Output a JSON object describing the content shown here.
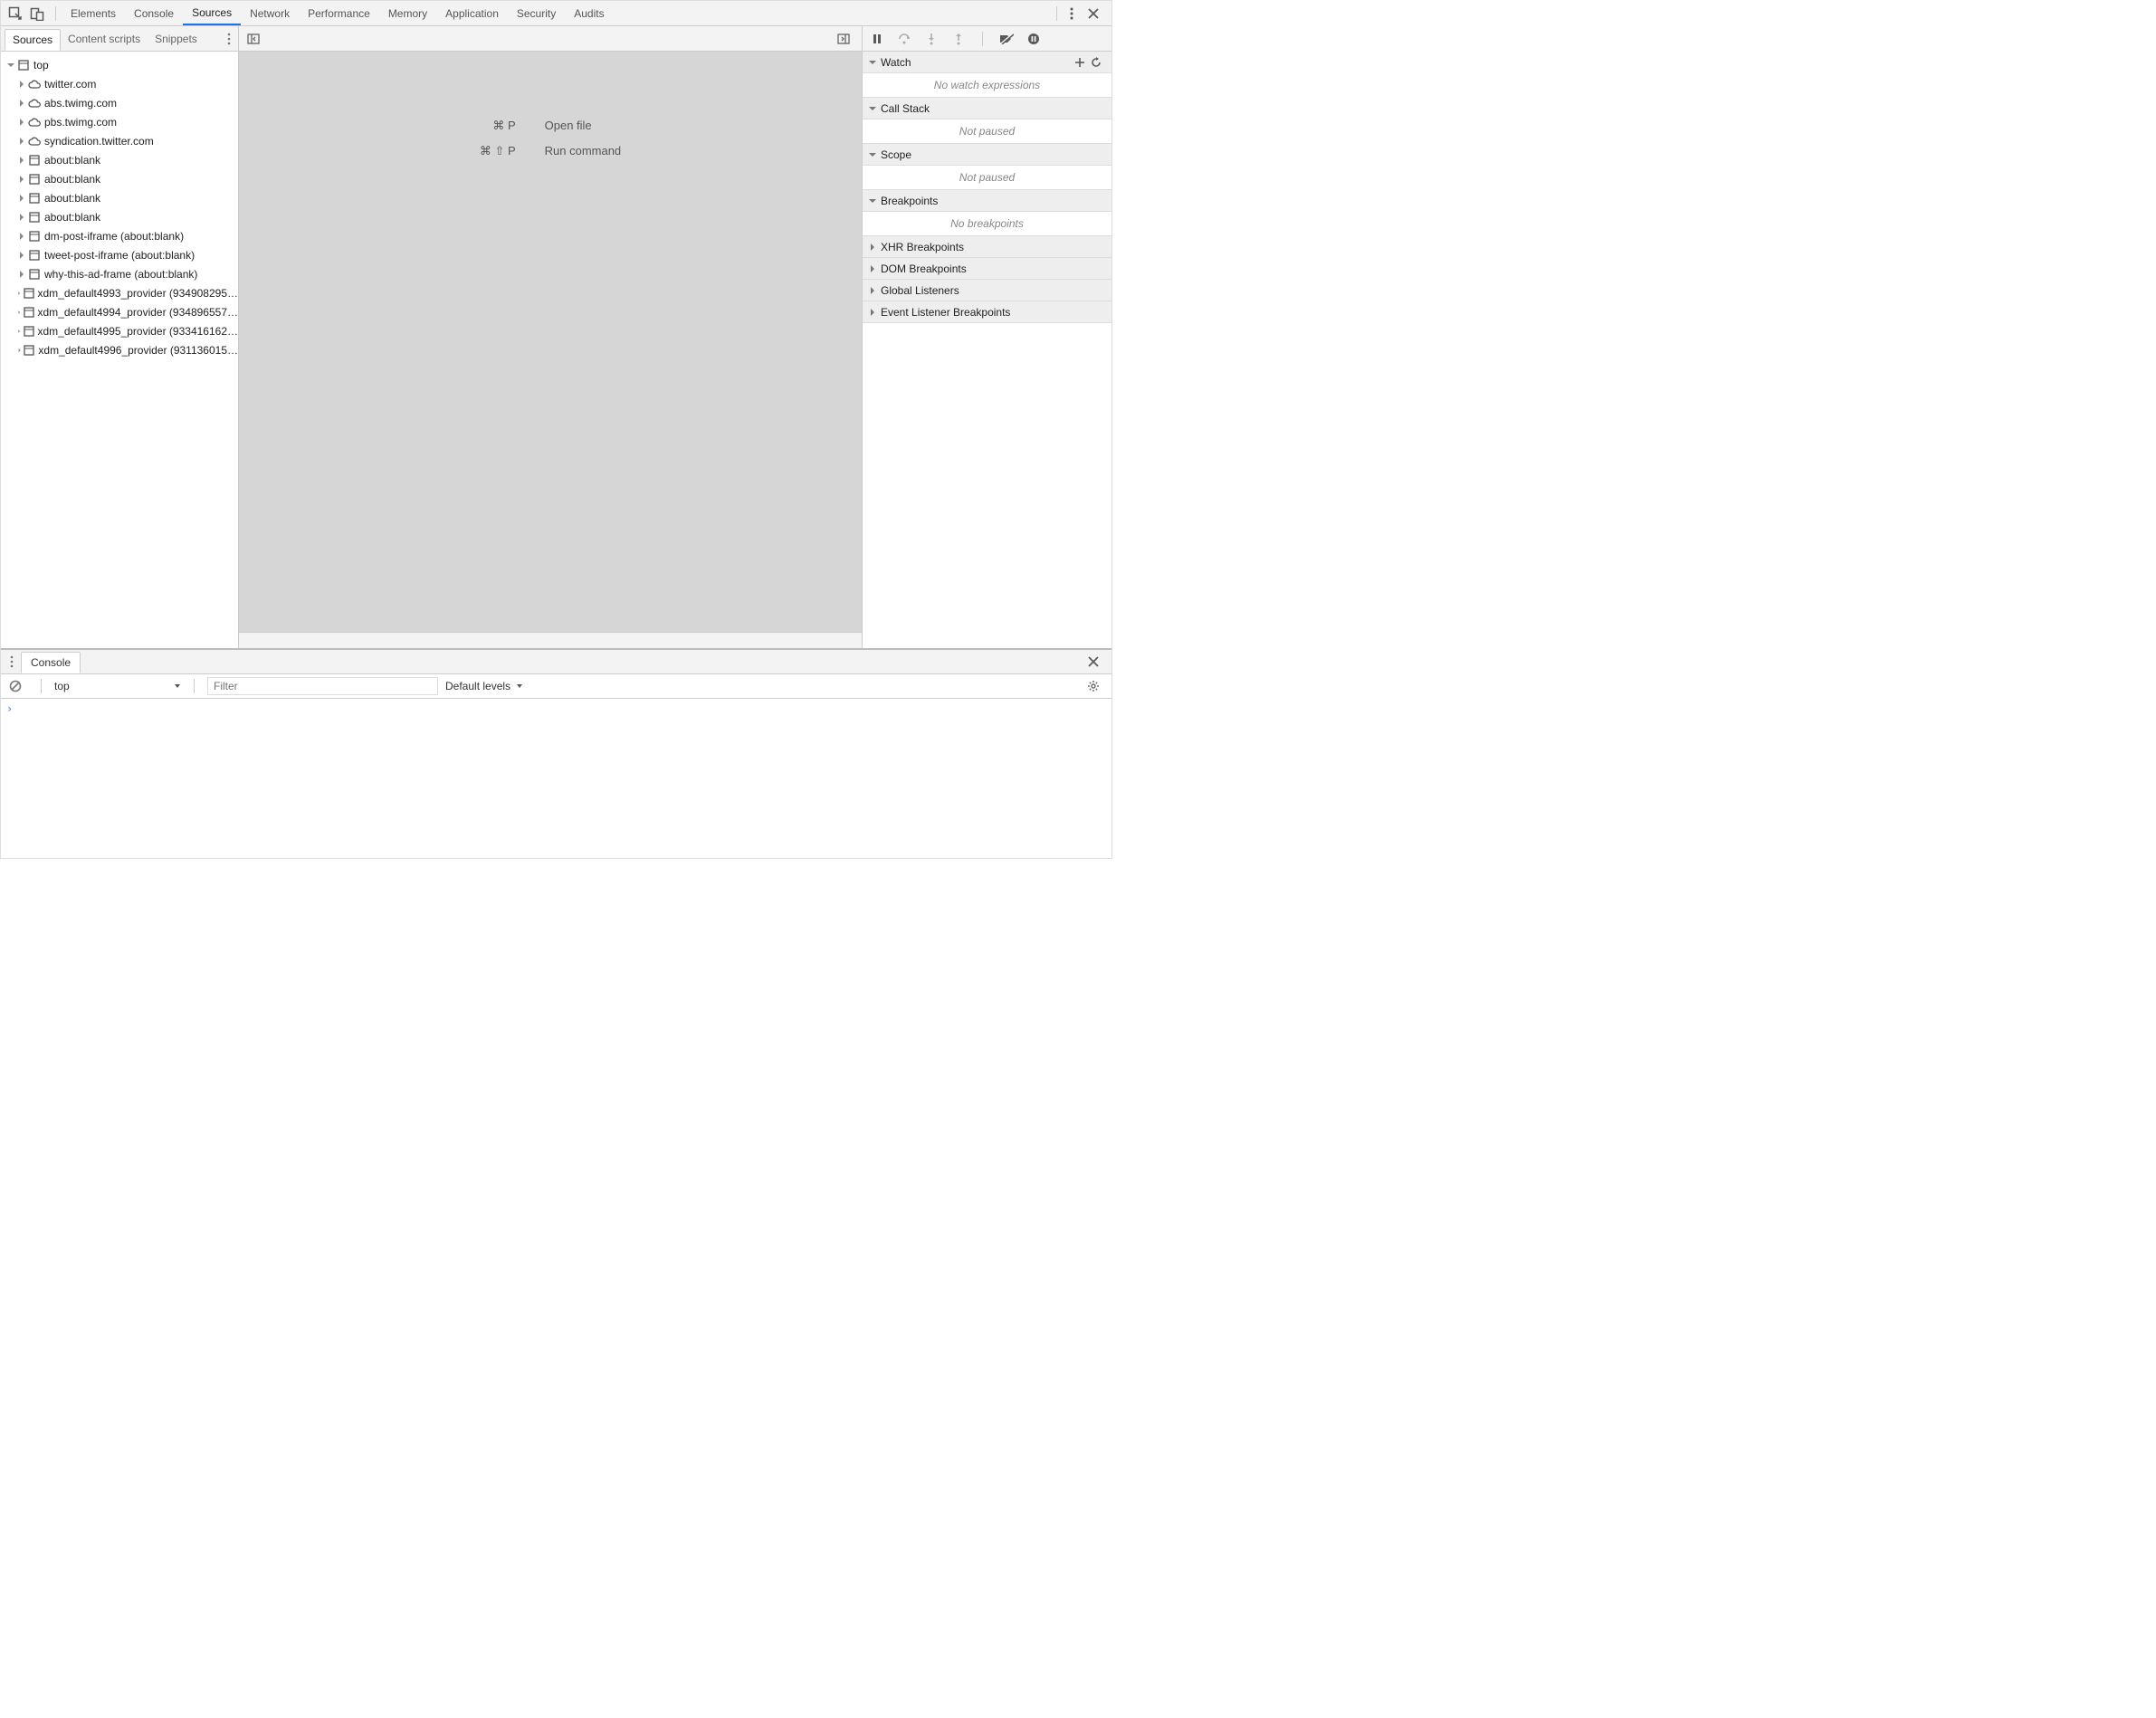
{
  "top": {
    "tabs": [
      "Elements",
      "Console",
      "Sources",
      "Network",
      "Performance",
      "Memory",
      "Application",
      "Security",
      "Audits"
    ],
    "active_tab": "Sources"
  },
  "navigator": {
    "tabs": [
      "Sources",
      "Content scripts",
      "Snippets"
    ],
    "active_tab": "Sources",
    "root_label": "top",
    "items": [
      {
        "label": "twitter.com",
        "icon": "cloud"
      },
      {
        "label": "abs.twimg.com",
        "icon": "cloud"
      },
      {
        "label": "pbs.twimg.com",
        "icon": "cloud"
      },
      {
        "label": "syndication.twitter.com",
        "icon": "cloud"
      },
      {
        "label": "about:blank",
        "icon": "frame"
      },
      {
        "label": "about:blank",
        "icon": "frame"
      },
      {
        "label": "about:blank",
        "icon": "frame"
      },
      {
        "label": "about:blank",
        "icon": "frame"
      },
      {
        "label": "dm-post-iframe (about:blank)",
        "icon": "frame"
      },
      {
        "label": "tweet-post-iframe (about:blank)",
        "icon": "frame"
      },
      {
        "label": "why-this-ad-frame (about:blank)",
        "icon": "frame"
      },
      {
        "label": "xdm_default4993_provider (934908295…",
        "icon": "frame"
      },
      {
        "label": "xdm_default4994_provider (934896557…",
        "icon": "frame"
      },
      {
        "label": "xdm_default4995_provider (933416162…",
        "icon": "frame"
      },
      {
        "label": "xdm_default4996_provider (931136015…",
        "icon": "frame"
      }
    ]
  },
  "editor": {
    "hints": [
      {
        "key": "⌘ P",
        "label": "Open file"
      },
      {
        "key": "⌘ ⇧ P",
        "label": "Run command"
      }
    ]
  },
  "panels": {
    "watch": {
      "title": "Watch",
      "body": "No watch expressions"
    },
    "callstack": {
      "title": "Call Stack",
      "body": "Not paused"
    },
    "scope": {
      "title": "Scope",
      "body": "Not paused"
    },
    "breakpoints": {
      "title": "Breakpoints",
      "body": "No breakpoints"
    },
    "xhr": {
      "title": "XHR Breakpoints"
    },
    "dom": {
      "title": "DOM Breakpoints"
    },
    "global": {
      "title": "Global Listeners"
    },
    "event": {
      "title": "Event Listener Breakpoints"
    }
  },
  "drawer": {
    "tab": "Console",
    "context": "top",
    "filter_placeholder": "Filter",
    "levels": "Default levels",
    "prompt": "›"
  }
}
